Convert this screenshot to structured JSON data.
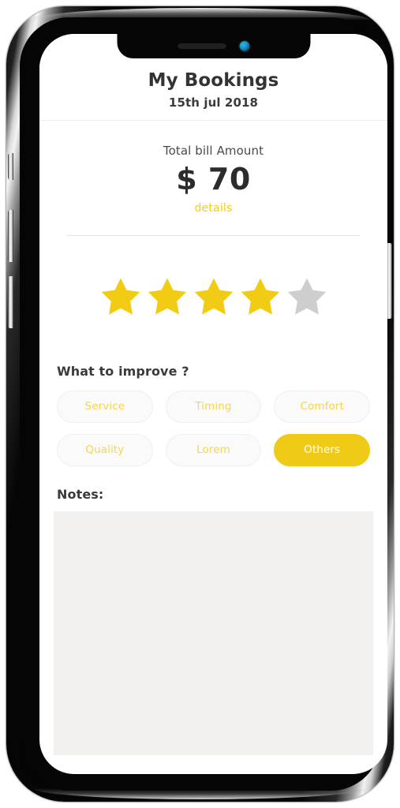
{
  "device": {
    "notch": {
      "speaker_name": "earpiece-speaker",
      "camera_name": "front-camera"
    },
    "buttons": [
      "mute-switch",
      "volume-up",
      "volume-down",
      "power"
    ]
  },
  "header": {
    "title": "My Bookings",
    "date": "15th jul 2018"
  },
  "bill": {
    "label": "Total bill Amount",
    "amount": "$ 70",
    "details_link": "details"
  },
  "rating": {
    "value": 4,
    "max": 5,
    "filled_color": "#F2CC14",
    "empty_color": "#CECECE"
  },
  "improve": {
    "title": "What to improve ?",
    "options": [
      {
        "label": "Service",
        "selected": false
      },
      {
        "label": "Timing",
        "selected": false
      },
      {
        "label": "Comfort",
        "selected": false
      },
      {
        "label": "Quality",
        "selected": false
      },
      {
        "label": "Lorem",
        "selected": false
      },
      {
        "label": "Others",
        "selected": true
      }
    ]
  },
  "notes": {
    "label": "Notes:",
    "value": "",
    "placeholder": ""
  },
  "theme": {
    "accent": "#EFCB16",
    "accent_text": "#F6D54A",
    "text_dark": "#333333",
    "surface": "#F2F1EF"
  }
}
